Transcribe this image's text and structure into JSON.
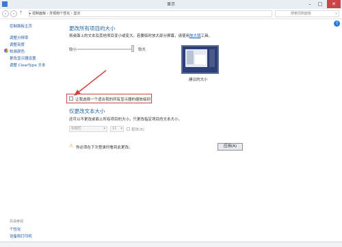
{
  "window": {
    "title": "显示"
  },
  "address": {
    "path": "▸  控制面板  ›  外观和个性化  ›  显示",
    "search_placeholder": "搜索控制面板"
  },
  "sidebar": {
    "items": [
      {
        "label": "控制面板主页"
      },
      {
        "label": "调整分辨率"
      },
      {
        "label": "调整亮度"
      },
      {
        "label": "校准颜色"
      },
      {
        "label": "更改显示器设置"
      },
      {
        "label": "调整 ClearType 文本"
      }
    ],
    "see_also_label": "另请参阅",
    "see_also": [
      {
        "label": "个性化"
      },
      {
        "label": "设备和打印机"
      }
    ]
  },
  "main": {
    "heading": "更改所有项目的大小",
    "desc": "将桌面上的文本及其他项目变小或变大。若要临时放大部分屏幕，请使用",
    "desc_link": "放大镜",
    "desc_end": "工具。",
    "slider": {
      "min_label": "较小",
      "max_label": "较大",
      "level": 1.0
    },
    "preview_caption": "建议的大小",
    "checkbox_label": "让我选择一个适合我的所有显示器的缩放级别",
    "text_heading": "仅更改文本大小",
    "text_desc": "还可以不更改桌面上所有项目的大小，只更改指定项目的文本大小。",
    "item_select": "标题栏",
    "size_select": "11",
    "bold_label": "粗体(B)",
    "warning": "你必须在下次登录时看到此更改。",
    "apply_button": "应用(A)"
  },
  "colors": {
    "accent": "#1f63a9",
    "highlight": "#d0453d"
  }
}
